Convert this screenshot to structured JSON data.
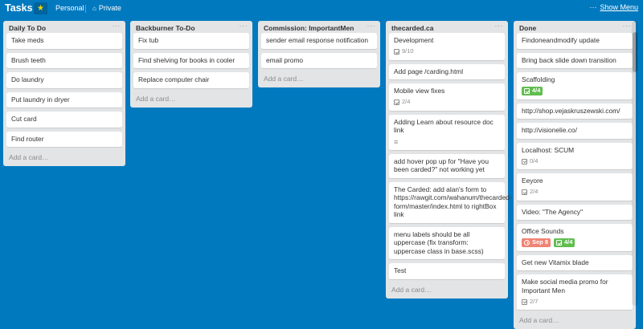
{
  "board": {
    "title": "Tasks",
    "visibility_team": "Personal",
    "visibility_privacy": "Private",
    "show_menu_dots": "···",
    "show_menu": "Show Menu",
    "star_icon": "star-icon",
    "star_color": "#f2d600"
  },
  "colors": {
    "background": "#0079bf",
    "list_bg": "#e2e4e6",
    "label_green": "#61bd4f",
    "label_red": "#eb5a46"
  },
  "add_card_label": "Add a card…",
  "list_menu": "···",
  "lists": [
    {
      "title": "Daily To Do",
      "cards": [
        {
          "text": "Take meds"
        },
        {
          "text": "Brush teeth"
        },
        {
          "text": "Do laundry"
        },
        {
          "text": "Put laundry in dryer"
        },
        {
          "text": "Cut card"
        },
        {
          "text": "Find router"
        }
      ]
    },
    {
      "title": "Backburner To-Do",
      "cards": [
        {
          "text": "Fix tub"
        },
        {
          "text": "Find shelving for books in cooler"
        },
        {
          "text": "Replace computer chair"
        }
      ]
    },
    {
      "title": "Commission: ImportantMen",
      "cards": [
        {
          "text": "sender email response notification"
        },
        {
          "text": "email promo"
        }
      ]
    },
    {
      "title": "thecarded.ca",
      "cards": [
        {
          "text": "Development",
          "checklist": "9/10"
        },
        {
          "text": "Add page /carding.html"
        },
        {
          "text": "Mobile view fixes",
          "checklist": "2/4"
        },
        {
          "text": "Adding Learn about resource doc link",
          "description": true
        },
        {
          "text": "add hover pop up for \"Have you been carded?\" not working yet"
        },
        {
          "text": "The Carded: add alan's form to https://rawgit.com/wahanum/thecarded-form/master/index.html to rightBox link"
        },
        {
          "text": "menu labels should be all uppercase (fix transform: uppercase class in base.scss)"
        },
        {
          "text": "Test"
        }
      ]
    },
    {
      "title": "Done",
      "cards": [
        {
          "text": "Findoneandmodify update"
        },
        {
          "text": "Bring back slide down transition"
        },
        {
          "text": "Scaffolding",
          "checklist_done": "4/4"
        },
        {
          "text": "http://shop.vejaskruszewski.com/"
        },
        {
          "text": "http://visionelie.co/"
        },
        {
          "text": "Localhost: SCUM",
          "checklist": "0/4"
        },
        {
          "text": "Eeyore",
          "checklist": "2/4"
        },
        {
          "text": "Video: \"The Agency\""
        },
        {
          "text": "Office Sounds",
          "due": "Sep 8",
          "checklist_done": "4/4"
        },
        {
          "text": "Get new Vitamix blade"
        },
        {
          "text": "Make social media promo for Important Men",
          "checklist": "2/7"
        }
      ]
    }
  ]
}
